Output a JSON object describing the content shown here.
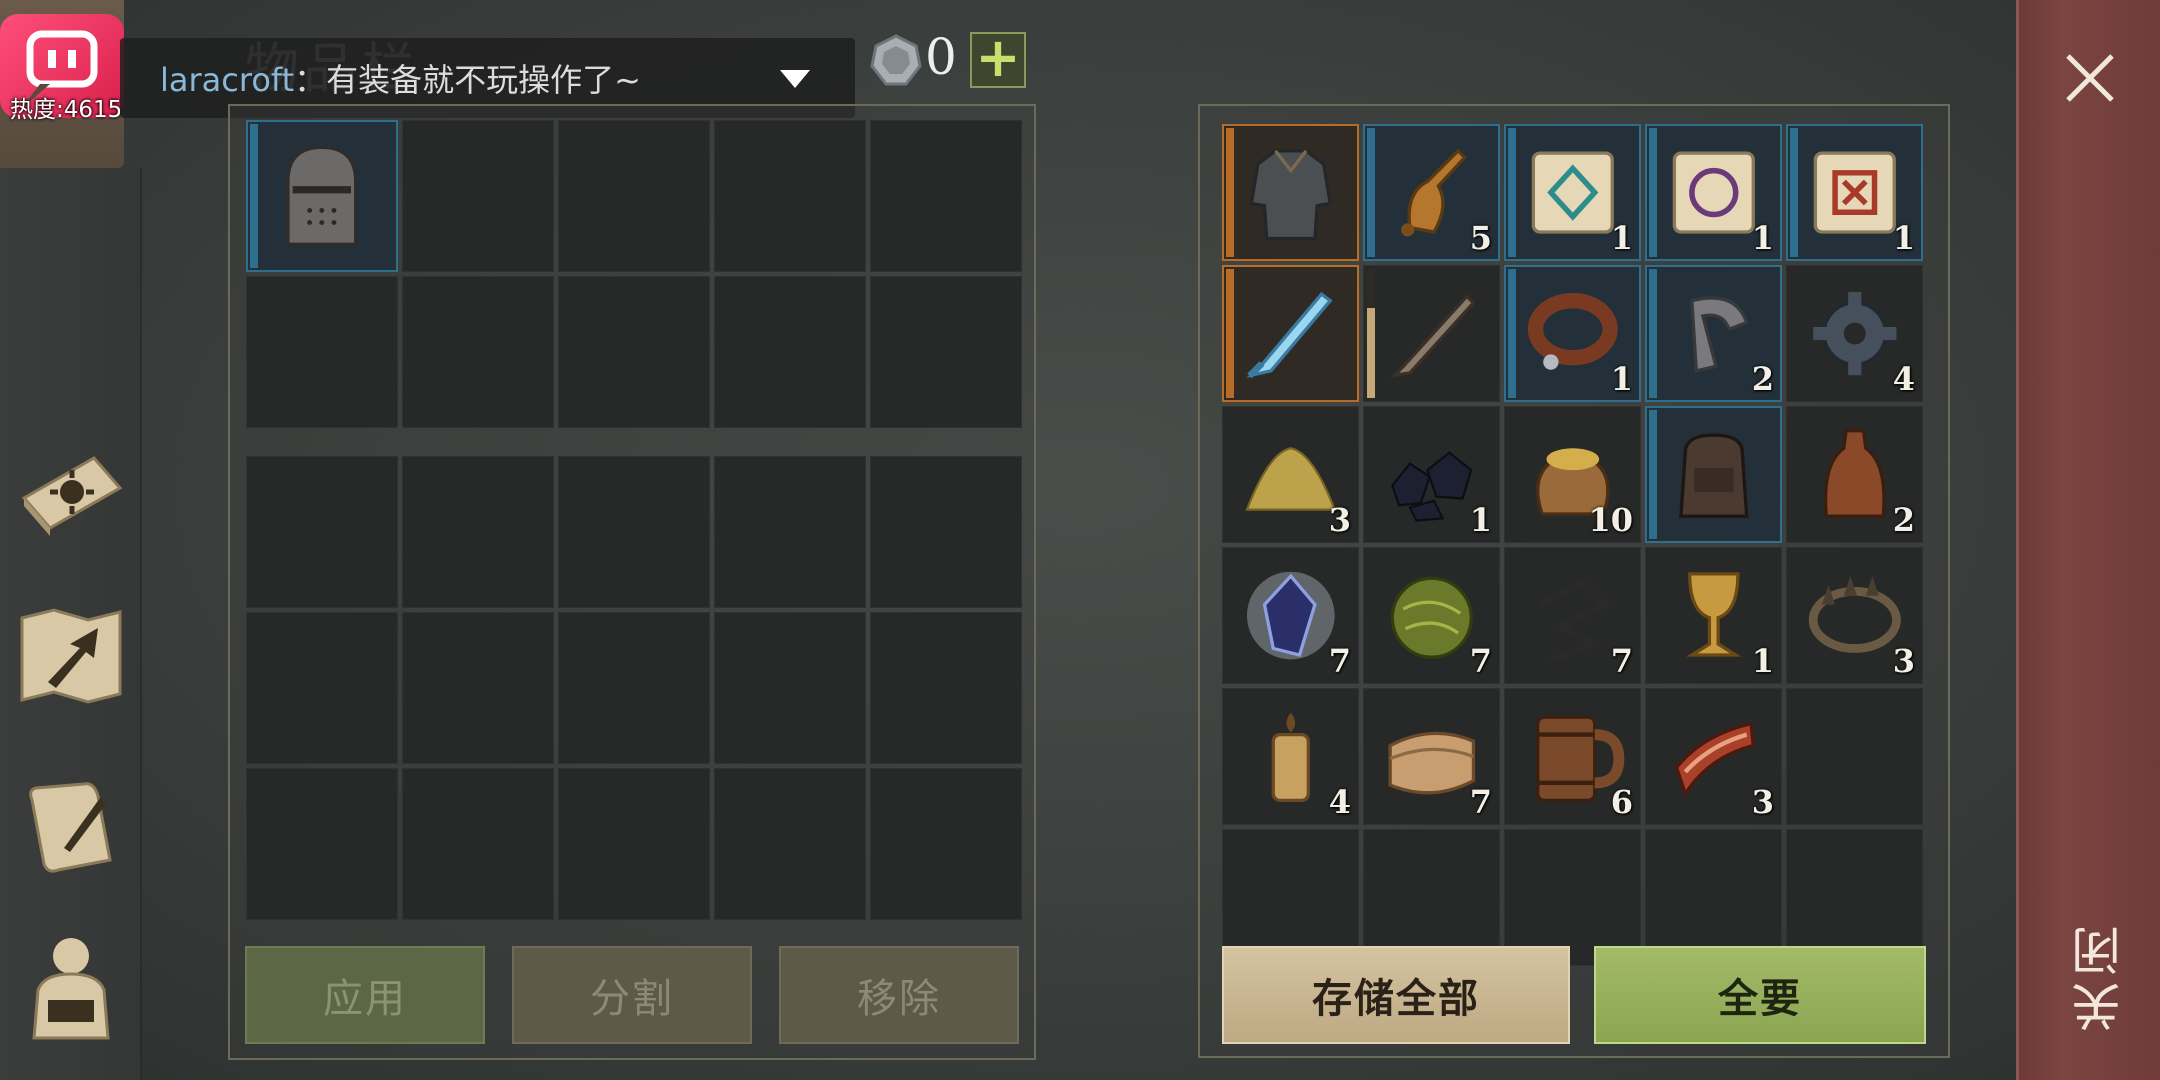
{
  "stream": {
    "heat_label": "热度:4615",
    "chat_user": "laracroft",
    "chat_message": "：有装备就不玩操作了~"
  },
  "header": {
    "title": "物品栏",
    "currency_count": "0",
    "currency_icon": "silver-coin-icon"
  },
  "sidebar": {
    "items": [
      {
        "name": "crafting-book",
        "icon": "sun-book-icon"
      },
      {
        "name": "map",
        "icon": "map-arrow-icon"
      },
      {
        "name": "quests",
        "icon": "scroll-quill-icon"
      },
      {
        "name": "character",
        "icon": "character-backpack-icon"
      }
    ]
  },
  "left_inventory": {
    "top_slots": [
      {
        "icon": "great-helm-icon",
        "qty": "",
        "rarity": "rare"
      },
      {},
      {},
      {},
      {},
      {},
      {},
      {},
      {},
      {}
    ],
    "bottom_slots": [
      {},
      {},
      {},
      {},
      {},
      {},
      {},
      {},
      {},
      {},
      {},
      {},
      {},
      {},
      {}
    ]
  },
  "chest_inventory": {
    "slots": [
      {
        "icon": "chainmail-armor-icon",
        "qty": "",
        "rarity": "epic"
      },
      {
        "icon": "bronze-bell-icon",
        "qty": "5",
        "rarity": "rare"
      },
      {
        "icon": "teal-rune-scroll-icon",
        "qty": "1",
        "rarity": "rare"
      },
      {
        "icon": "purple-rune-scroll-icon",
        "qty": "1",
        "rarity": "rare"
      },
      {
        "icon": "red-rune-scroll-icon",
        "qty": "1",
        "rarity": "rare"
      },
      {
        "icon": "ice-sword-icon",
        "qty": "",
        "rarity": "epic"
      },
      {
        "icon": "iron-sword-icon",
        "qty": "",
        "rarity": "common",
        "durability": 0.7
      },
      {
        "icon": "leather-collar-icon",
        "qty": "1",
        "rarity": "rare"
      },
      {
        "icon": "iron-shackle-icon",
        "qty": "2",
        "rarity": "rare"
      },
      {
        "icon": "gear-icon",
        "qty": "4",
        "rarity": "common"
      },
      {
        "icon": "sand-pile-icon",
        "qty": "3",
        "rarity": "common"
      },
      {
        "icon": "coal-icon",
        "qty": "1",
        "rarity": "common"
      },
      {
        "icon": "grain-sack-icon",
        "qty": "10",
        "rarity": "common"
      },
      {
        "icon": "leather-backpack-icon",
        "qty": "",
        "rarity": "rare"
      },
      {
        "icon": "clay-bottle-icon",
        "qty": "2",
        "rarity": "common"
      },
      {
        "icon": "blue-crystal-icon",
        "qty": "7",
        "rarity": "common"
      },
      {
        "icon": "herb-ball-icon",
        "qty": "7",
        "rarity": "common"
      },
      {
        "icon": "wire-coil-icon",
        "qty": "7",
        "rarity": "common"
      },
      {
        "icon": "golden-goblet-icon",
        "qty": "1",
        "rarity": "common"
      },
      {
        "icon": "bear-trap-icon",
        "qty": "3",
        "rarity": "common"
      },
      {
        "icon": "candle-icon",
        "qty": "4",
        "rarity": "common"
      },
      {
        "icon": "cloth-roll-icon",
        "qty": "7",
        "rarity": "common"
      },
      {
        "icon": "wooden-mug-icon",
        "qty": "6",
        "rarity": "common"
      },
      {
        "icon": "bacon-icon",
        "qty": "3",
        "rarity": "common"
      },
      {},
      {},
      {},
      {},
      {},
      {}
    ]
  },
  "buttons": {
    "apply": "应用",
    "split": "分割",
    "remove": "移除",
    "store_all": "存储全部",
    "take_all": "全要"
  },
  "close": {
    "label": "关闭",
    "icon": "close-icon"
  },
  "colors": {
    "rare_border": "#2d6f8c",
    "epic_border": "#b96b28",
    "take_button": "#8aa552",
    "store_button": "#bda983",
    "close_panel": "#7b4541"
  }
}
